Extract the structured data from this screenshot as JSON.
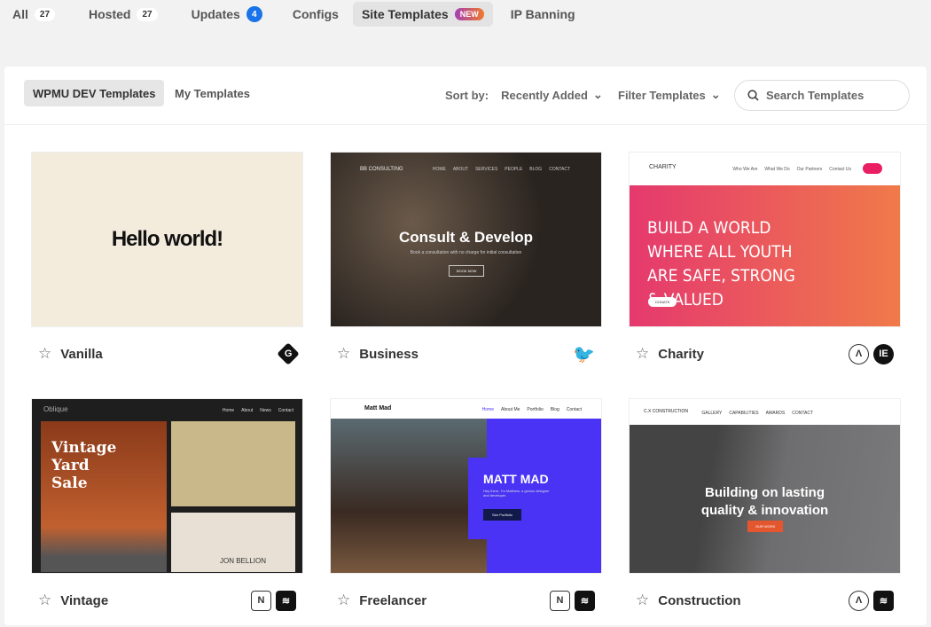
{
  "tabs": [
    {
      "label": "All",
      "count": "27"
    },
    {
      "label": "Hosted",
      "count": "27"
    },
    {
      "label": "Updates",
      "count": "4"
    },
    {
      "label": "Configs"
    },
    {
      "label": "Site Templates",
      "badge": "NEW"
    },
    {
      "label": "IP Banning"
    }
  ],
  "subtabs": [
    "WPMU DEV Templates",
    "My Templates"
  ],
  "sort": {
    "label": "Sort by:",
    "value": "Recently Added",
    "filter": "Filter Templates"
  },
  "search": {
    "placeholder": "Search Templates"
  },
  "colors": {
    "accent": "#1a73e8",
    "new_badge": "#a43fb6"
  },
  "cards": [
    {
      "title": "Vanilla",
      "preview": {
        "headline": "Hello world!"
      },
      "badges": [
        "gutenberg-icon"
      ]
    },
    {
      "title": "Business",
      "preview": {
        "brand": "BB CONSULTING",
        "nav": [
          "HOME",
          "ABOUT",
          "SERVICES",
          "PEOPLE",
          "BLOG",
          "CONTACT"
        ],
        "headline": "Consult & Develop",
        "sub": "Book a consultation with no charge for initial consultation",
        "cta": "BOOK NOW"
      },
      "badges": [
        "hummingbird-icon"
      ]
    },
    {
      "title": "Charity",
      "preview": {
        "brand": "CHARITY",
        "nav": [
          "Who We Are",
          "What We Do",
          "Our Partners",
          "Contact Us"
        ],
        "headline": "BUILD A WORLD WHERE ALL YOUTH ARE SAFE, STRONG & VALUED",
        "cta": "DONATE"
      },
      "badges": [
        "astra-icon",
        "elementor-icon"
      ]
    },
    {
      "title": "Vintage",
      "preview": {
        "brand": "Oblique",
        "nav": [
          "Home",
          "About",
          "News",
          "Contact"
        ],
        "headline": "Vintage Yard Sale",
        "caption": "JON BELLION"
      },
      "badges": [
        "neve-icon",
        "layers-icon"
      ]
    },
    {
      "title": "Freelancer",
      "preview": {
        "brand": "Matt Mad",
        "nav": [
          "Home",
          "About Me",
          "Portfolio",
          "Blog",
          "Contact"
        ],
        "headline": "MATT MAD",
        "sub": "Hey there, I'm Matthew, a genius designer and developer.",
        "cta": "See Portfolio"
      },
      "badges": [
        "neve-icon",
        "layers-icon"
      ]
    },
    {
      "title": "Construction",
      "preview": {
        "brand": "C.X CONSTRUCTION",
        "nav": [
          "GALLERY",
          "CAPABILITIES",
          "AWARDS",
          "CONTACT"
        ],
        "headline": "Building on lasting quality & innovation",
        "cta": "OUR WORK"
      },
      "badges": [
        "astra-icon",
        "layers-icon"
      ]
    }
  ]
}
